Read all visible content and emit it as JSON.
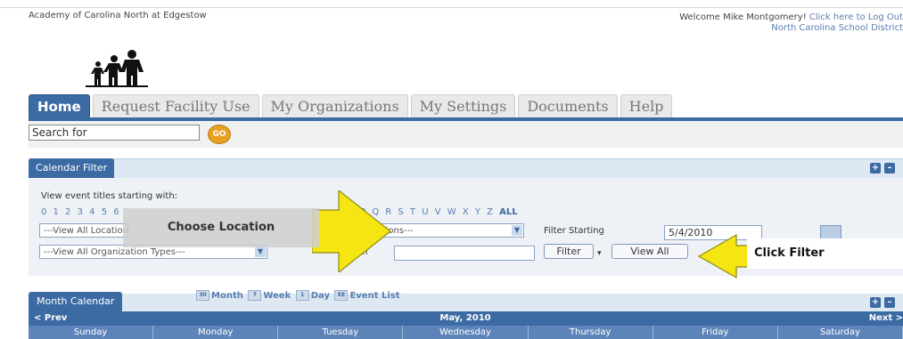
{
  "header": {
    "org_name": "Academy of Carolina North at Edgestow",
    "welcome_text": "Welcome Mike Montgomery!",
    "logout_link": "Click here to Log Out",
    "district": "North Carolina School District"
  },
  "tabs": [
    {
      "label": "Home",
      "active": true
    },
    {
      "label": "Request Facility Use",
      "active": false
    },
    {
      "label": "My Organizations",
      "active": false
    },
    {
      "label": "My Settings",
      "active": false
    },
    {
      "label": "Documents",
      "active": false
    },
    {
      "label": "Help",
      "active": false
    }
  ],
  "search": {
    "value": "Search for",
    "go_label": "GO"
  },
  "calendar_filter": {
    "title": "Calendar Filter",
    "starting_with_label": "View event titles starting with:",
    "letters_visible_left": "0 1 2 3 4 5 6",
    "letters_visible_right": "P Q R S T U V W X Y Z",
    "all_label": "ALL",
    "location_select": "---View All Locations---",
    "location_select_visible_tail": "cations---",
    "org_type_select": "---View All Organization Types---",
    "description_label": "Description",
    "description_visible": "on",
    "filter_starting_label": "Filter Starting",
    "filter_starting_value": "5/4/2010",
    "filter_button": "Filter",
    "view_all_button": "View All"
  },
  "annotations": {
    "choose_location": "Choose Location",
    "click_filter": "Click Filter"
  },
  "month_calendar": {
    "title": "Month Calendar",
    "views": [
      "Month",
      "Week",
      "Day",
      "Event List"
    ],
    "view_icons": [
      "30",
      "7",
      "1",
      "EE"
    ],
    "prev": "< Prev",
    "month": "May, 2010",
    "next": "Next >",
    "days": [
      "Sunday",
      "Monday",
      "Tuesday",
      "Wednesday",
      "Thursday",
      "Friday",
      "Saturday"
    ]
  },
  "colors": {
    "primary": "#3c6aa3",
    "arrow_yellow": "#f4e513",
    "go_orange": "#e8a020"
  }
}
